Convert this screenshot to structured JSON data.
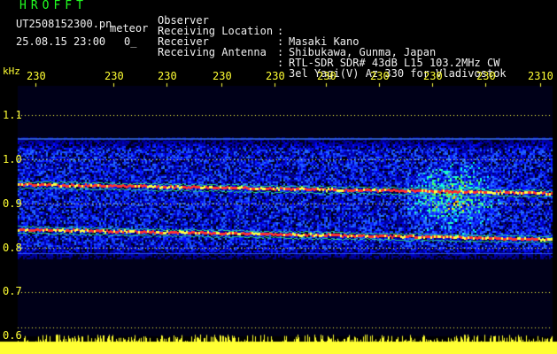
{
  "header": {
    "title": "HROFFT",
    "file_label": "UT2508152300.pn",
    "meteor_label": "meteor",
    "datetime": "25.08.15 23:00",
    "counter": "0_"
  },
  "info": {
    "observer_label": "Observer",
    "observer": "Masaki Kano",
    "location_label": "Receiving Location",
    "location": "Shibukawa, Gunma, Japan",
    "receiver_label": "Receiver",
    "receiver": "RTL-SDR SDR# 43dB L15 103.2MHz CW",
    "antenna_label": "Receiving Antenna",
    "antenna": "3el Yagi(V) Az 330 for Vladivostok",
    "separator": ":"
  },
  "axes": {
    "y_unit": "kHz",
    "y_ticks": [
      "1.1",
      "1.0",
      "0.9",
      "0.8",
      "0.7",
      "0.6"
    ],
    "x_ticks": [
      "230",
      "230",
      "230",
      "230",
      "230",
      "230",
      "230",
      "230",
      "230",
      "2310"
    ]
  },
  "colors": {
    "background": "#000000",
    "header_green": "#22ff22",
    "label_yellow": "#ffff33",
    "signal_red": "#ff3030",
    "noise_blue": "#1e3cff"
  }
}
